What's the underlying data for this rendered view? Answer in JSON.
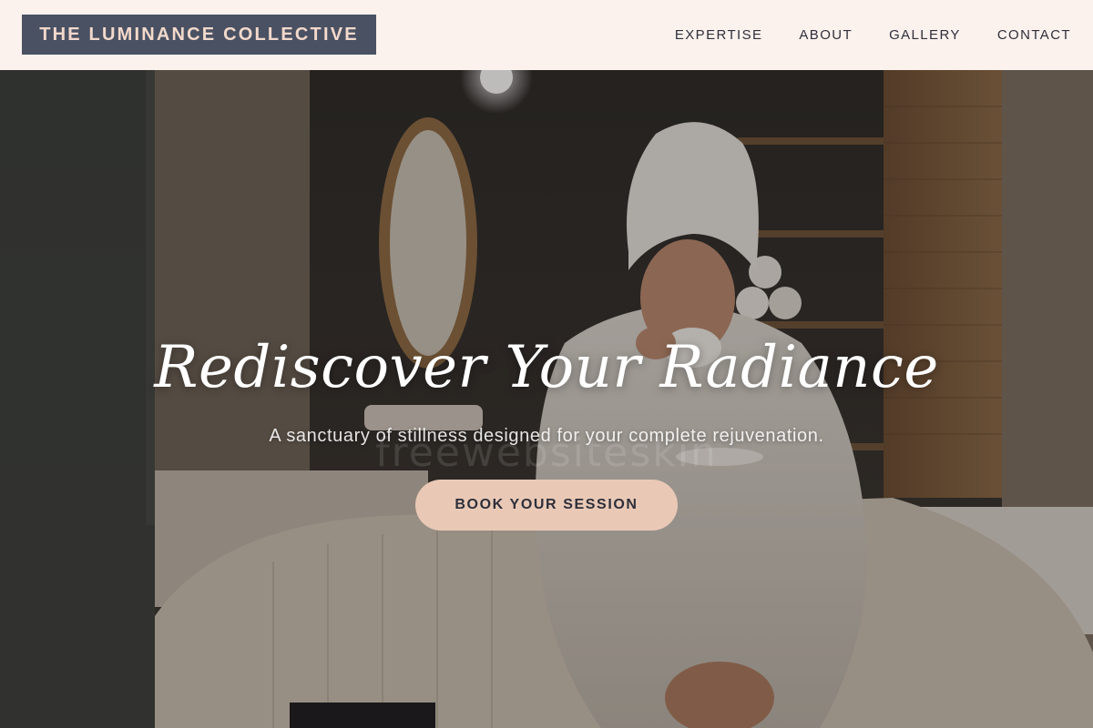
{
  "brand": {
    "name": "THE LUMINANCE COLLECTIVE"
  },
  "nav": {
    "items": [
      {
        "label": "EXPERTISE"
      },
      {
        "label": "ABOUT"
      },
      {
        "label": "GALLERY"
      },
      {
        "label": "CONTACT"
      }
    ]
  },
  "hero": {
    "headline": "Rediscover Your Radiance",
    "subheadline": "A sanctuary of stillness designed for your complete rejuvenation.",
    "cta_label": "BOOK YOUR SESSION",
    "image_subject": "woman in white robe and towel turban sipping from a cup in a spa room",
    "watermark": "freewebsiteskin"
  },
  "colors": {
    "header_bg": "#fbf1ed",
    "logo_bg": "#4a5163",
    "logo_text": "#f2d9cb",
    "nav_text": "#2e2f3a",
    "cta_bg": "#e9c9b6",
    "cta_text": "#2e2f3a"
  }
}
